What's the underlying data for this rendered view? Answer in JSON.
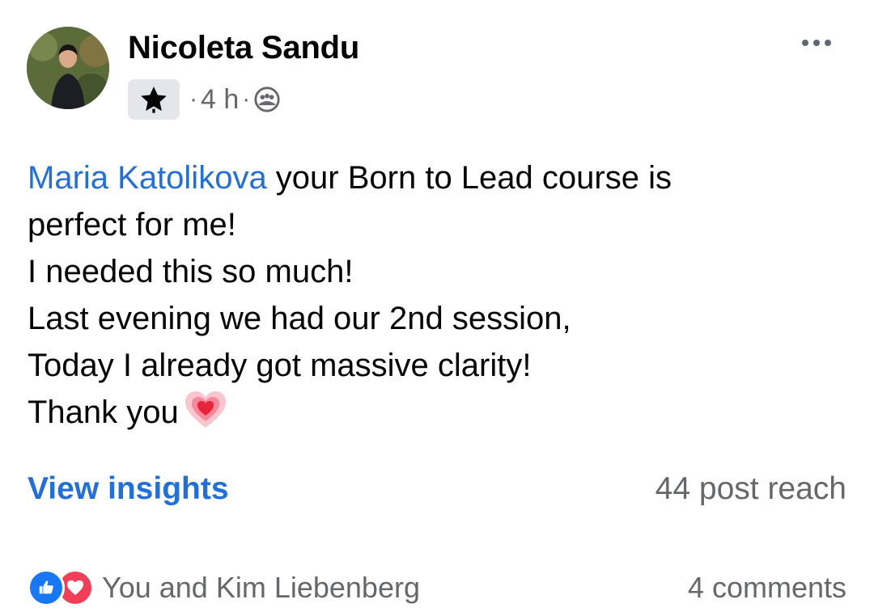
{
  "post": {
    "author": "Nicoleta Sandu",
    "timestamp": "4 h",
    "badge_icon": "star-icon",
    "privacy_icon": "group-icon",
    "more_icon": "more-horizontal-icon",
    "mention": "Maria Katolikova",
    "text_line1_rest": " your Born to Lead course is",
    "text_line2": "perfect for me!",
    "text_line3": "I needed this so much!",
    "text_line4": "Last evening we had our 2nd session,",
    "text_line5": "Today I already got massive clarity!",
    "text_line6": "Thank you",
    "emoji_icon": "growing-heart-icon"
  },
  "insights": {
    "link_label": "View insights",
    "reach_text": "44 post reach"
  },
  "footer": {
    "reaction_icons": [
      "like-icon",
      "love-icon"
    ],
    "reaction_names": "You and Kim Liebenberg",
    "comments_label": "4 comments"
  },
  "colors": {
    "link_blue": "#216fdb",
    "secondary_gray": "#65676b",
    "like_blue": "#1877f2",
    "love_red": "#f33e58"
  }
}
